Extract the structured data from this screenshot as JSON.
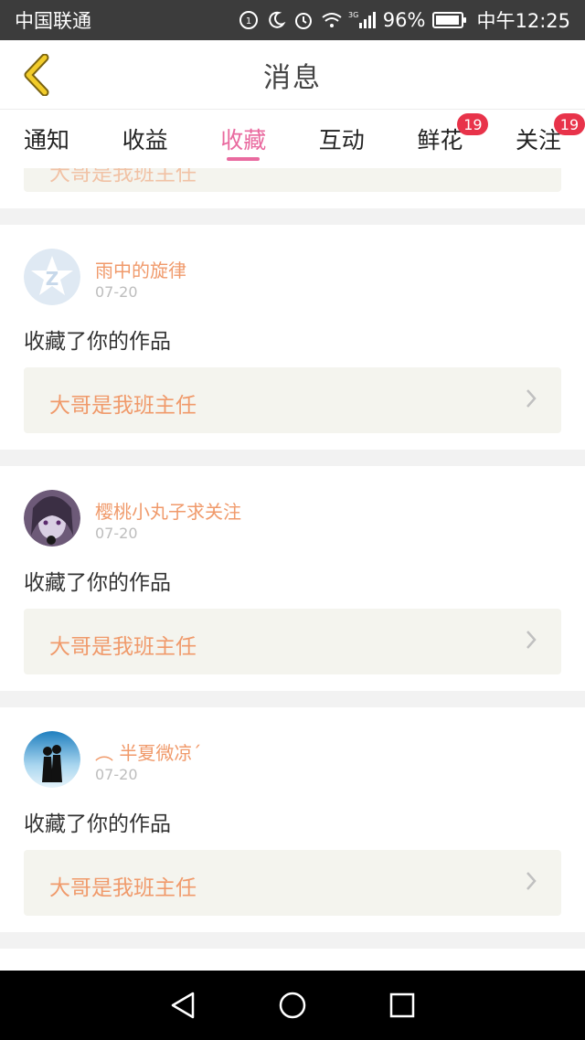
{
  "status_bar": {
    "carrier": "中国联通",
    "network": "3G",
    "battery": "96%",
    "battery_level": 0.96,
    "time": "中午12:25"
  },
  "header": {
    "title": "消息"
  },
  "tabs": [
    {
      "label": "通知",
      "active": false,
      "badge": ""
    },
    {
      "label": "收益",
      "active": false,
      "badge": ""
    },
    {
      "label": "收藏",
      "active": true,
      "badge": ""
    },
    {
      "label": "互动",
      "active": false,
      "badge": ""
    },
    {
      "label": "鲜花",
      "active": false,
      "badge": "19"
    },
    {
      "label": "关注",
      "active": false,
      "badge": "19"
    }
  ],
  "partial_top": {
    "work_title": "大哥是我班主任"
  },
  "messages": [
    {
      "username": "雨中的旋律",
      "date": "07-20",
      "action": "收藏了你的作品",
      "work_title": "大哥是我班主任",
      "avatar": "default-star-avatar"
    },
    {
      "username": "樱桃小丸子求关注",
      "date": "07-20",
      "action": "收藏了你的作品",
      "work_title": "大哥是我班主任",
      "avatar": "anime-girl-avatar"
    },
    {
      "username": "︵ 半夏微凉ˊ",
      "date": "07-20",
      "action": "收藏了你的作品",
      "work_title": "大哥是我班主任",
      "avatar": "couple-silhouette-avatar"
    }
  ],
  "colors": {
    "accent_pink": "#e96a9f",
    "username_orange": "#f09a6b",
    "badge_red": "#e8334a",
    "back_arrow": "#e2b81f"
  }
}
